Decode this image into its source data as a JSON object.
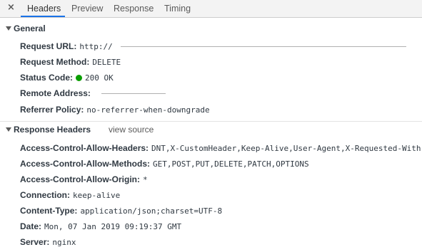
{
  "tabs": [
    {
      "label": "Headers"
    },
    {
      "label": "Preview"
    },
    {
      "label": "Response"
    },
    {
      "label": "Timing"
    }
  ],
  "close_glyph": "×",
  "general": {
    "title": "General",
    "rows": [
      {
        "key": "Request URL:",
        "value": "http://"
      },
      {
        "key": "Request Method:",
        "value": "DELETE"
      },
      {
        "key": "Status Code:",
        "value": "200 OK"
      },
      {
        "key": "Remote Address:",
        "value": ""
      },
      {
        "key": "Referrer Policy:",
        "value": "no-referrer-when-downgrade"
      }
    ]
  },
  "response_headers": {
    "title": "Response Headers",
    "view_source": "view source",
    "rows": [
      {
        "key": "Access-Control-Allow-Headers:",
        "value": "DNT,X-CustomHeader,Keep-Alive,User-Agent,X-Requested-With,"
      },
      {
        "key": "Access-Control-Allow-Methods:",
        "value": "GET,POST,PUT,DELETE,PATCH,OPTIONS"
      },
      {
        "key": "Access-Control-Allow-Origin:",
        "value": "*"
      },
      {
        "key": "Connection:",
        "value": "keep-alive"
      },
      {
        "key": "Content-Type:",
        "value": "application/json;charset=UTF-8"
      },
      {
        "key": "Date:",
        "value": "Mon, 07 Jan 2019 09:19:37 GMT"
      },
      {
        "key": "Server:",
        "value": "nginx"
      }
    ]
  },
  "colors": {
    "status_ok": "#0a9e01",
    "active_tab": "#1a73e8"
  }
}
